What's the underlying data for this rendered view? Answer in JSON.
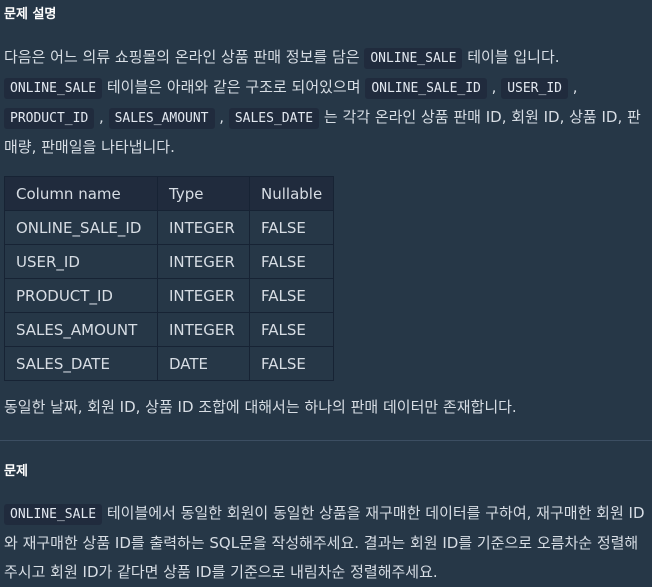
{
  "section1": {
    "heading": "문제 설명",
    "intro_1": "다음은 어느 의류 쇼핑몰의 온라인 상품 판매 정보를 담은 ",
    "intro_code": "ONLINE_SALE",
    "intro_2": " 테이블 입니다.",
    "desc_code1": "ONLINE_SALE",
    "desc_1": " 테이블은 아래와 같은 구조로 되어있으며 ",
    "desc_code2": "ONLINE_SALE_ID",
    "sep1": " , ",
    "desc_code3": "USER_ID",
    "sep2": " , ",
    "desc_code4": "PRODUCT_ID",
    "sep3": " , ",
    "desc_code5": "SALES_AMOUNT",
    "sep4": " , ",
    "desc_code6": "SALES_DATE",
    "desc_2": " 는 각각 온라인 상품 판매 ID, 회원 ID, 상품 ID, 판매량, 판매일을 나타냅니다.",
    "table": {
      "headers": [
        "Column name",
        "Type",
        "Nullable"
      ],
      "rows": [
        [
          "ONLINE_SALE_ID",
          "INTEGER",
          "FALSE"
        ],
        [
          "USER_ID",
          "INTEGER",
          "FALSE"
        ],
        [
          "PRODUCT_ID",
          "INTEGER",
          "FALSE"
        ],
        [
          "SALES_AMOUNT",
          "INTEGER",
          "FALSE"
        ],
        [
          "SALES_DATE",
          "DATE",
          "FALSE"
        ]
      ]
    },
    "note": "동일한 날짜, 회원 ID, 상품 ID 조합에 대해서는 하나의 판매 데이터만 존재합니다."
  },
  "section2": {
    "heading": "문제",
    "code": "ONLINE_SALE",
    "text": " 테이블에서 동일한 회원이 동일한 상품을 재구매한 데이터를 구하여, 재구매한 회원 ID와 재구매한 상품 ID를 출력하는 SQL문을 작성해주세요. 결과는 회원 ID를 기준으로 오름차순 정렬해주시고 회원 ID가 같다면 상품 ID를 기준으로 내림차순 정렬해주세요."
  }
}
